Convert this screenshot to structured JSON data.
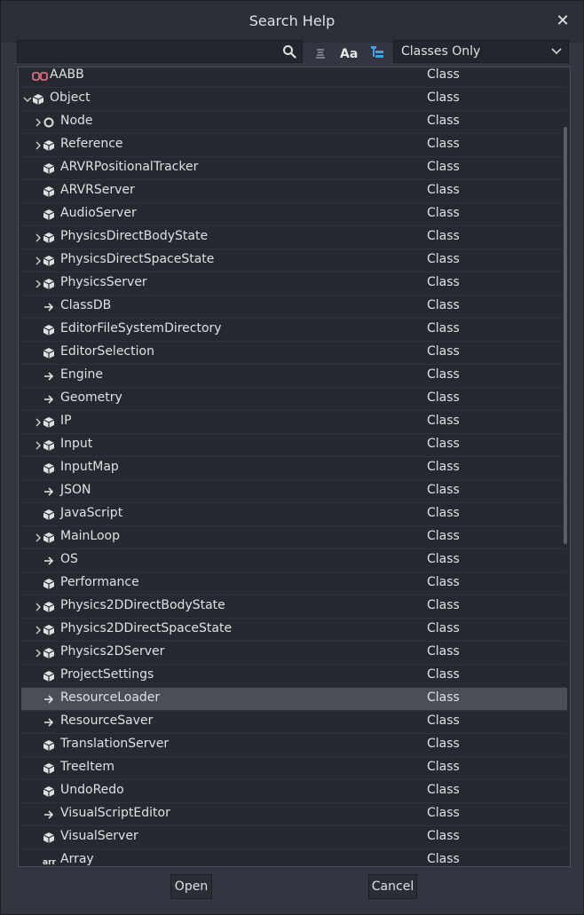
{
  "dialog": {
    "title": "Search Help",
    "close_label": "✕"
  },
  "search": {
    "value": "",
    "placeholder": ""
  },
  "toolbar": {
    "case_label": "Aa"
  },
  "filter": {
    "selected": "Classes Only"
  },
  "tree": {
    "rows": [
      {
        "name": "AABB",
        "type": "Class",
        "icon": "aabb-icon",
        "arrow": "none"
      },
      {
        "name": "Object",
        "type": "Class",
        "icon": "object-icon",
        "arrow": "expanded"
      },
      {
        "name": "Node",
        "type": "Class",
        "icon": "node-icon",
        "arrow": "collapsed"
      },
      {
        "name": "Reference",
        "type": "Class",
        "icon": "object-icon",
        "arrow": "collapsed"
      },
      {
        "name": "ARVRPositionalTracker",
        "type": "Class",
        "icon": "object-icon",
        "arrow": "none"
      },
      {
        "name": "ARVRServer",
        "type": "Class",
        "icon": "object-icon",
        "arrow": "none"
      },
      {
        "name": "AudioServer",
        "type": "Class",
        "icon": "object-icon",
        "arrow": "none"
      },
      {
        "name": "PhysicsDirectBodyState",
        "type": "Class",
        "icon": "object-icon",
        "arrow": "collapsed"
      },
      {
        "name": "PhysicsDirectSpaceState",
        "type": "Class",
        "icon": "object-icon",
        "arrow": "collapsed"
      },
      {
        "name": "PhysicsServer",
        "type": "Class",
        "icon": "object-icon",
        "arrow": "collapsed"
      },
      {
        "name": "ClassDB",
        "type": "Class",
        "icon": "arrow-right-icon",
        "arrow": "none"
      },
      {
        "name": "EditorFileSystemDirectory",
        "type": "Class",
        "icon": "object-icon",
        "arrow": "none"
      },
      {
        "name": "EditorSelection",
        "type": "Class",
        "icon": "object-icon",
        "arrow": "none"
      },
      {
        "name": "Engine",
        "type": "Class",
        "icon": "arrow-right-icon",
        "arrow": "none"
      },
      {
        "name": "Geometry",
        "type": "Class",
        "icon": "arrow-right-icon",
        "arrow": "none"
      },
      {
        "name": "IP",
        "type": "Class",
        "icon": "object-icon",
        "arrow": "collapsed"
      },
      {
        "name": "Input",
        "type": "Class",
        "icon": "object-icon",
        "arrow": "collapsed"
      },
      {
        "name": "InputMap",
        "type": "Class",
        "icon": "object-icon",
        "arrow": "none"
      },
      {
        "name": "JSON",
        "type": "Class",
        "icon": "arrow-right-icon",
        "arrow": "none"
      },
      {
        "name": "JavaScript",
        "type": "Class",
        "icon": "object-icon",
        "arrow": "none"
      },
      {
        "name": "MainLoop",
        "type": "Class",
        "icon": "object-icon",
        "arrow": "collapsed"
      },
      {
        "name": "OS",
        "type": "Class",
        "icon": "arrow-right-icon",
        "arrow": "none"
      },
      {
        "name": "Performance",
        "type": "Class",
        "icon": "object-icon",
        "arrow": "none"
      },
      {
        "name": "Physics2DDirectBodyState",
        "type": "Class",
        "icon": "object-icon",
        "arrow": "collapsed"
      },
      {
        "name": "Physics2DDirectSpaceState",
        "type": "Class",
        "icon": "object-icon",
        "arrow": "collapsed"
      },
      {
        "name": "Physics2DServer",
        "type": "Class",
        "icon": "object-icon",
        "arrow": "collapsed"
      },
      {
        "name": "ProjectSettings",
        "type": "Class",
        "icon": "object-icon",
        "arrow": "none"
      },
      {
        "name": "ResourceLoader",
        "type": "Class",
        "icon": "arrow-right-icon",
        "arrow": "none",
        "selected": true
      },
      {
        "name": "ResourceSaver",
        "type": "Class",
        "icon": "arrow-right-icon",
        "arrow": "none"
      },
      {
        "name": "TranslationServer",
        "type": "Class",
        "icon": "object-icon",
        "arrow": "none"
      },
      {
        "name": "TreeItem",
        "type": "Class",
        "icon": "object-icon",
        "arrow": "none"
      },
      {
        "name": "UndoRedo",
        "type": "Class",
        "icon": "object-icon",
        "arrow": "none"
      },
      {
        "name": "VisualScriptEditor",
        "type": "Class",
        "icon": "arrow-right-icon",
        "arrow": "none"
      },
      {
        "name": "VisualServer",
        "type": "Class",
        "icon": "object-icon",
        "arrow": "none"
      },
      {
        "name": "Array",
        "type": "Class",
        "icon": "array-icon",
        "arrow": "none",
        "icon_text": "arr"
      }
    ]
  },
  "footer": {
    "open_label": "Open",
    "cancel_label": "Cancel"
  },
  "colors": {
    "accent": "#3da0f0",
    "aabb": "#f7718a",
    "selected_row": "#4a4e56"
  }
}
